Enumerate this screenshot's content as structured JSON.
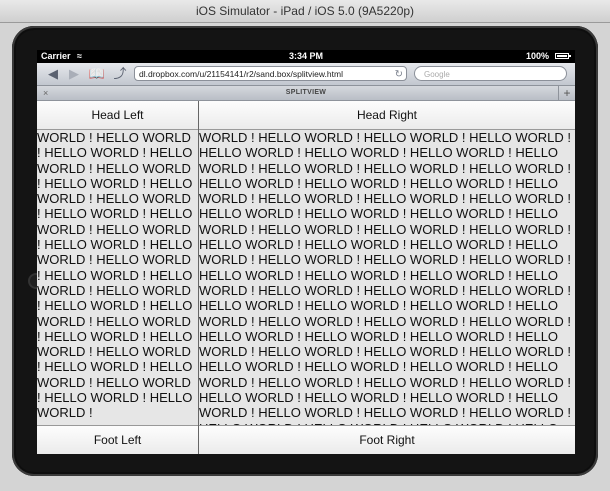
{
  "window": {
    "title": "iOS Simulator - iPad / iOS 5.0 (9A5220p)"
  },
  "status_bar": {
    "carrier": "Carrier",
    "time": "3:34 PM",
    "battery": "100%"
  },
  "toolbar": {
    "back_icon": "back-arrow-icon",
    "forward_icon": "forward-arrow-icon",
    "bookmarks_icon": "bookmarks-icon",
    "share_icon": "share-icon",
    "url": "dl.dropbox.com/u/21154141/r2/sand.box/splitview.html",
    "search_placeholder": "Google"
  },
  "tab": {
    "title": "SPLITVIEW",
    "close_label": "×",
    "add_label": "+"
  },
  "page": {
    "head_left": "Head Left",
    "head_right": "Head Right",
    "foot_left": "Foot Left",
    "foot_right": "Foot Right",
    "left_pane_text": "WORLD ! HELLO WORLD ! HELLO WORLD ! HELLO WORLD ! HELLO WORLD ! HELLO WORLD ! HELLO WORLD ! HELLO WORLD ! HELLO WORLD ! HELLO WORLD ! HELLO WORLD ! HELLO WORLD ! HELLO WORLD ! HELLO WORLD ! HELLO WORLD ! HELLO WORLD ! HELLO WORLD ! HELLO WORLD ! HELLO WORLD ! HELLO WORLD ! HELLO WORLD ! HELLO WORLD ! HELLO WORLD ! HELLO WORLD ! HELLO WORLD ! HELLO WORLD ! HELLO WORLD ! HELLO WORLD !",
    "right_pane_text": "WORLD ! HELLO WORLD ! HELLO WORLD ! HELLO WORLD ! HELLO WORLD ! HELLO WORLD ! HELLO WORLD ! HELLO WORLD ! HELLO WORLD ! HELLO WORLD ! HELLO WORLD ! HELLO WORLD ! HELLO WORLD ! HELLO WORLD ! HELLO WORLD ! HELLO WORLD ! HELLO WORLD ! HELLO WORLD ! HELLO WORLD ! HELLO WORLD ! HELLO WORLD ! HELLO WORLD ! HELLO WORLD ! HELLO WORLD ! HELLO WORLD ! HELLO WORLD ! HELLO WORLD ! HELLO WORLD ! HELLO WORLD ! HELLO WORLD ! HELLO WORLD ! HELLO WORLD ! HELLO WORLD ! HELLO WORLD ! HELLO WORLD ! HELLO WORLD ! HELLO WORLD ! HELLO WORLD ! HELLO WORLD ! HELLO WORLD ! HELLO WORLD ! HELLO WORLD ! HELLO WORLD ! HELLO WORLD ! HELLO WORLD ! HELLO WORLD ! HELLO WORLD ! HELLO WORLD ! HELLO WORLD ! HELLO WORLD ! HELLO WORLD ! HELLO WORLD ! HELLO WORLD ! HELLO WORLD ! HELLO WORLD ! HELLO WORLD ! HELLO WORLD ! HELLO WORLD ! HELLO WORLD ! HELLO WORLD ! HELLO WORLD ! HELLO WORLD ! HELLO WORLD ! HELLO WORLD ! HELLO WORLD ! HELLO WORLD ! HELLO WORLD ! HELLO WORLD ! HELLO WORLD ! HELLO WORLD ! HELLO WORLD ! HELLO WORLD ! HELLO WORLD ! HELLO WORLD ! HELLO WORLD ! HELLO WORLD ! HELLO WORLD ! HELLO WORLD ! HELLO WORLD ! HELLO WORLD ! HELLO WORLD ! HELLO WORLD ! HELLO WORLD ! HELLO WORLD ! HELLO WORLD ! HELLO WORLD ! HELLO WORLD ! HELLO WORLD ! HELLO WORLD ! HELLO WORLD !"
  }
}
